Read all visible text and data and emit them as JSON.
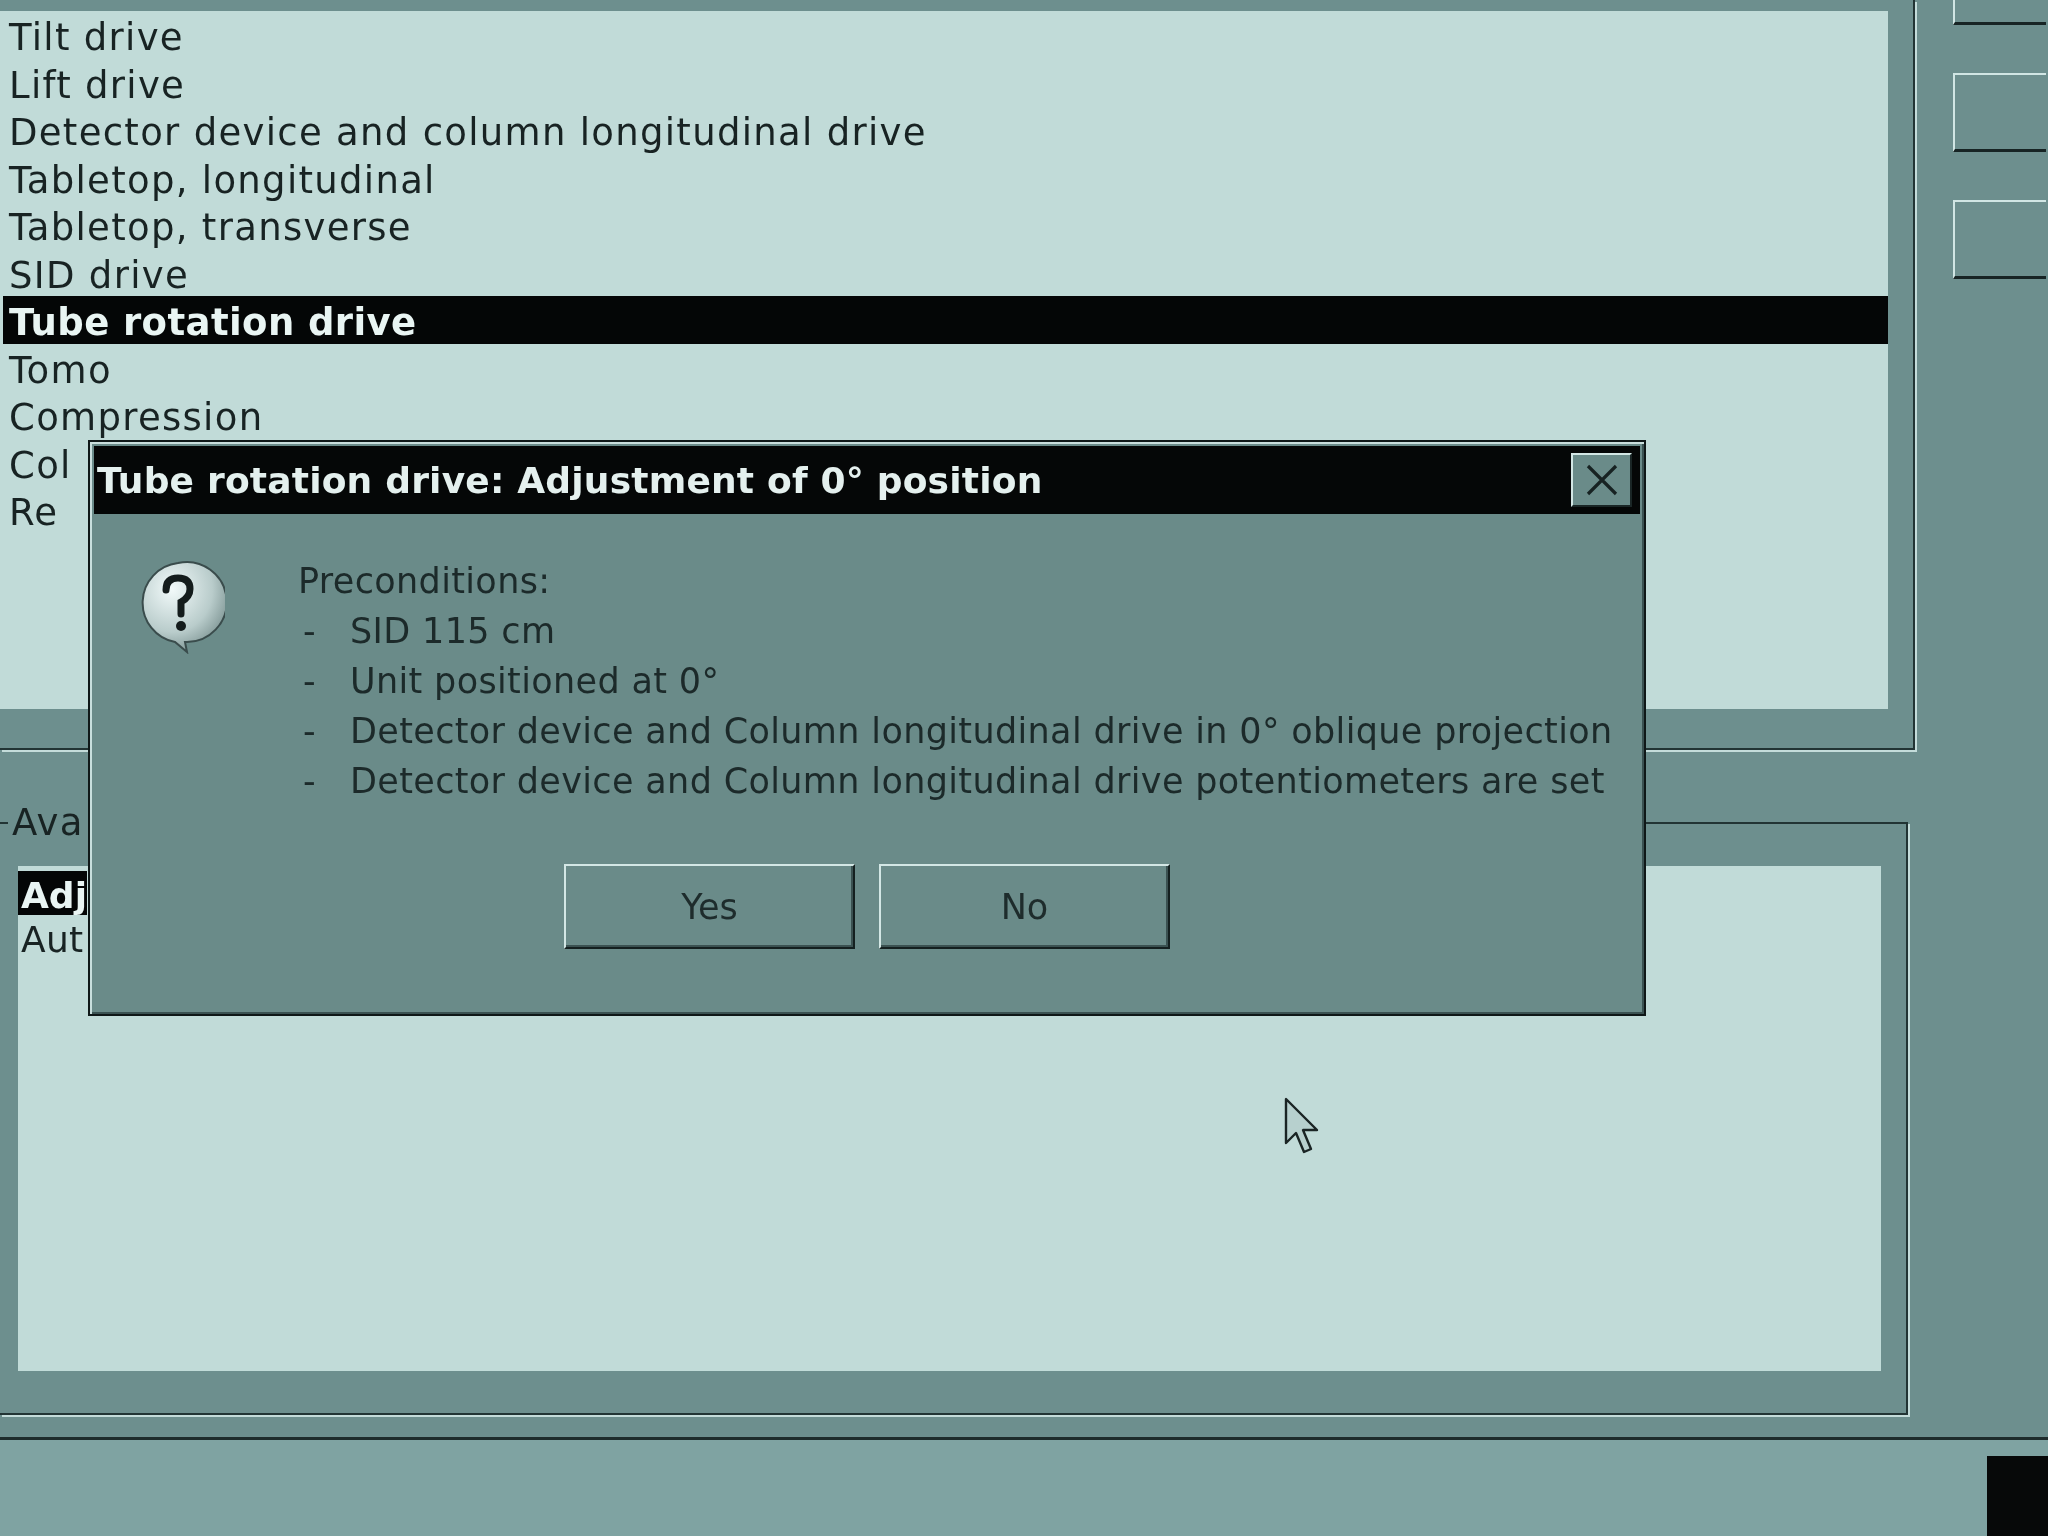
{
  "drive_list": {
    "items": [
      {
        "label": "Tilt drive",
        "selected": false
      },
      {
        "label": "Lift drive",
        "selected": false
      },
      {
        "label": "Detector device and column longitudinal drive",
        "selected": false
      },
      {
        "label": "Tabletop, longitudinal",
        "selected": false
      },
      {
        "label": "Tabletop, transverse",
        "selected": false
      },
      {
        "label": "SID drive",
        "selected": false
      },
      {
        "label": "Tube rotation drive",
        "selected": true
      },
      {
        "label": "Tomo",
        "selected": false
      },
      {
        "label": "Compression",
        "selected": false
      },
      {
        "label": "Col",
        "selected": false
      },
      {
        "label": "Re",
        "selected": false
      }
    ]
  },
  "available_group": {
    "label": "Ava",
    "items": [
      {
        "label": "Adj",
        "selected": true
      },
      {
        "label": "Aut",
        "selected": false
      }
    ]
  },
  "dialog": {
    "title": "Tube rotation drive: Adjustment of 0° position",
    "heading": "Preconditions:",
    "items": [
      {
        "marker": "-",
        "text": "SID 115 cm"
      },
      {
        "marker": "-",
        "text": "Unit positioned at 0°"
      },
      {
        "marker": "-",
        "text": "Detector device and Column longitudinal drive in 0° oblique projection"
      },
      {
        "marker": "-",
        "text": "Detector device and Column longitudinal drive potentiometers are set"
      }
    ],
    "buttons": [
      "Yes",
      "No"
    ]
  }
}
